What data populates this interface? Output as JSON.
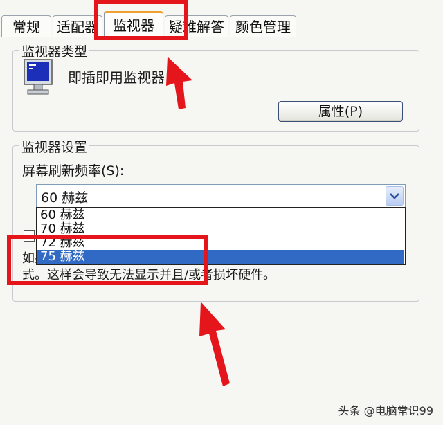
{
  "tabs": [
    {
      "label": "常规"
    },
    {
      "label": "适配器"
    },
    {
      "label": "监视器"
    },
    {
      "label": "疑难解答"
    },
    {
      "label": "颜色管理"
    }
  ],
  "monitor_type_group": {
    "title": "监视器类型",
    "monitor_name": "即插即用监视器",
    "properties_button": "属性(P)"
  },
  "monitor_settings_group": {
    "title": "监视器设置",
    "refresh_label": "屏幕刷新频率(S):",
    "selected_value": "60 赫兹",
    "options": [
      "60 赫兹",
      "70 赫兹",
      "72 赫兹",
      "75 赫兹"
    ],
    "selected_option_index": 3,
    "warning_text": "如果取消选中此复选框，您可以选择该监视器无法正确显示的显示模式。这样会导致无法显示并且/或者损坏硬件。"
  },
  "colors": {
    "annotation_red": "#e4151b",
    "selection_blue": "#316ac5",
    "active_tab_accent": "#f0a030"
  },
  "watermark": "头条 @电脑常识99"
}
